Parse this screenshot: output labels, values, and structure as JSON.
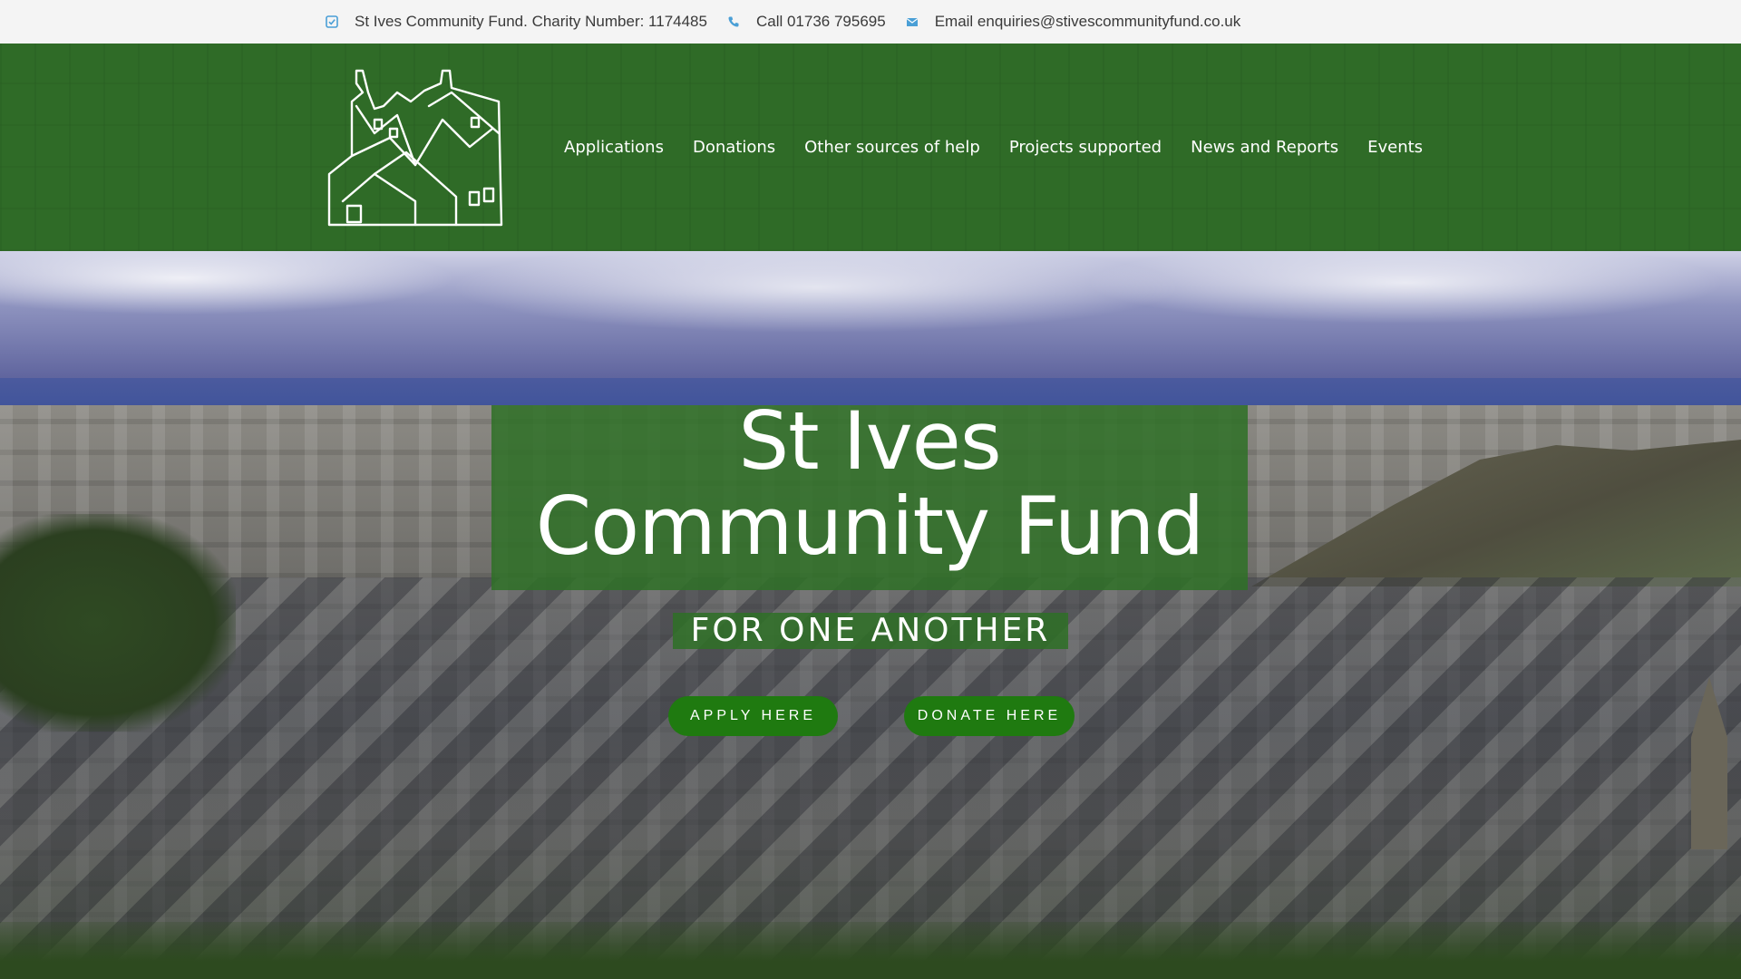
{
  "topbar": {
    "charity": "St Ives Community Fund. Charity Number: 1174485",
    "phone": "Call 01736 795695",
    "email": "Email enquiries@stivescommunityfund.co.uk",
    "icons": [
      "check-square-icon",
      "phone-icon",
      "envelope-icon"
    ],
    "icon_color": "#4a9fd6"
  },
  "header": {
    "background": "#2f6b27",
    "logo_icon": "houses-line-drawing-logo",
    "nav": [
      {
        "label": "Applications"
      },
      {
        "label": "Donations"
      },
      {
        "label": "Other sources of help"
      },
      {
        "label": "Projects supported"
      },
      {
        "label": "News and Reports"
      },
      {
        "label": "Events"
      }
    ]
  },
  "hero": {
    "title_line1": "St Ives",
    "title_line2": "Community Fund",
    "subtitle": "FOR ONE ANOTHER",
    "apply_label": "APPLY HERE",
    "donate_label": "DONATE HERE",
    "button_color": "#1f7a10"
  }
}
